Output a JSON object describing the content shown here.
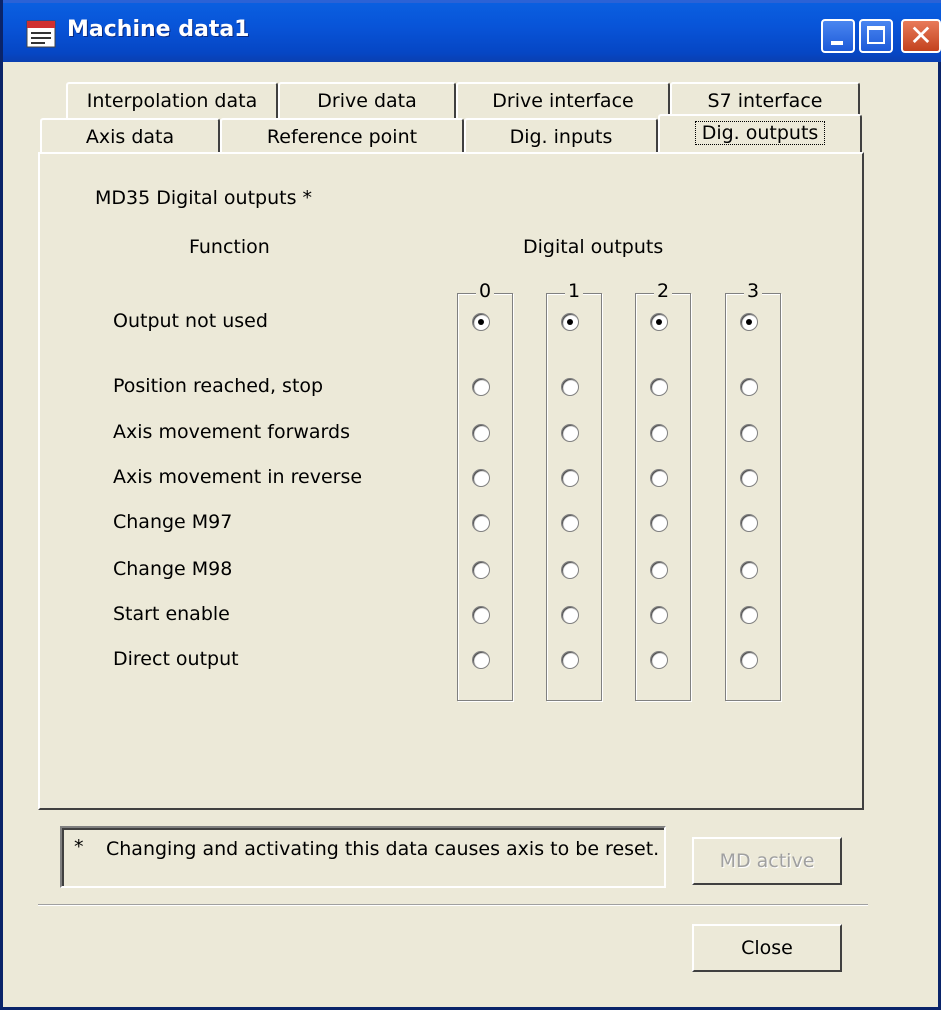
{
  "window": {
    "title": "Machine data1"
  },
  "tabs_row1": [
    "Interpolation data",
    "Drive data",
    "Drive interface",
    "S7 interface"
  ],
  "tabs_row2": [
    "Axis data",
    "Reference point",
    "Dig. inputs",
    "Dig. outputs"
  ],
  "active_tab": "Dig. outputs",
  "section": {
    "heading": "MD35 Digital outputs *",
    "function_label": "Function",
    "outputs_label": "Digital outputs",
    "columns": [
      "0",
      "1",
      "2",
      "3"
    ],
    "rows": [
      "Output not used",
      "Position reached, stop",
      "Axis movement forwards",
      "Axis movement in reverse",
      "Change M97",
      "Change M98",
      "Start enable",
      "Direct output"
    ],
    "selected_row_per_column": [
      0,
      0,
      0,
      0
    ]
  },
  "note": {
    "asterisk": "*",
    "text": "Changing and activating this data causes axis to be reset."
  },
  "buttons": {
    "md_active": "MD active",
    "close": "Close"
  }
}
